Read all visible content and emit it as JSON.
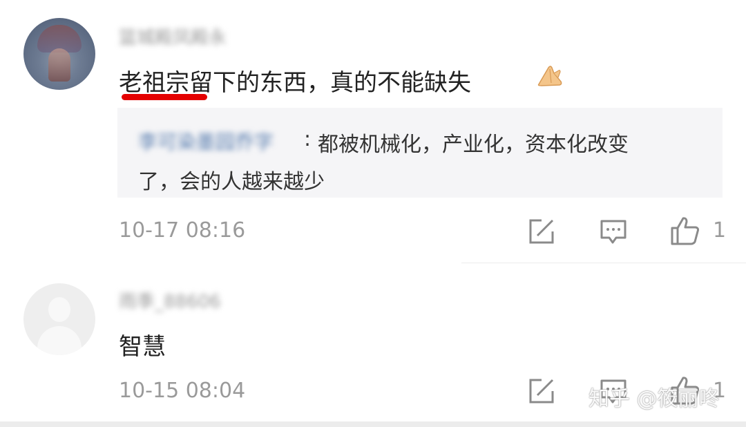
{
  "comments": [
    {
      "username": "篮城殿凤殿永",
      "text": "老祖宗留下的东西，真的不能缺失",
      "emoji": "folded-hands-emoji",
      "reply": {
        "username": "李可染墨园乔字",
        "colon": ":",
        "line1": "都被机械化，产业化，资本化改变",
        "line2": "了，会的人越来越少"
      },
      "timestamp": "10-17 08:16",
      "like_count": "1"
    },
    {
      "username": "雨季_88606",
      "text": "智慧",
      "timestamp": "10-15 08:04",
      "like_count": "1"
    }
  ],
  "watermark": "知乎 @筱丽咚",
  "colors": {
    "highlight_underline": "#e40000",
    "reply_user": "#5b7fb0",
    "muted": "#9a9a9a"
  }
}
